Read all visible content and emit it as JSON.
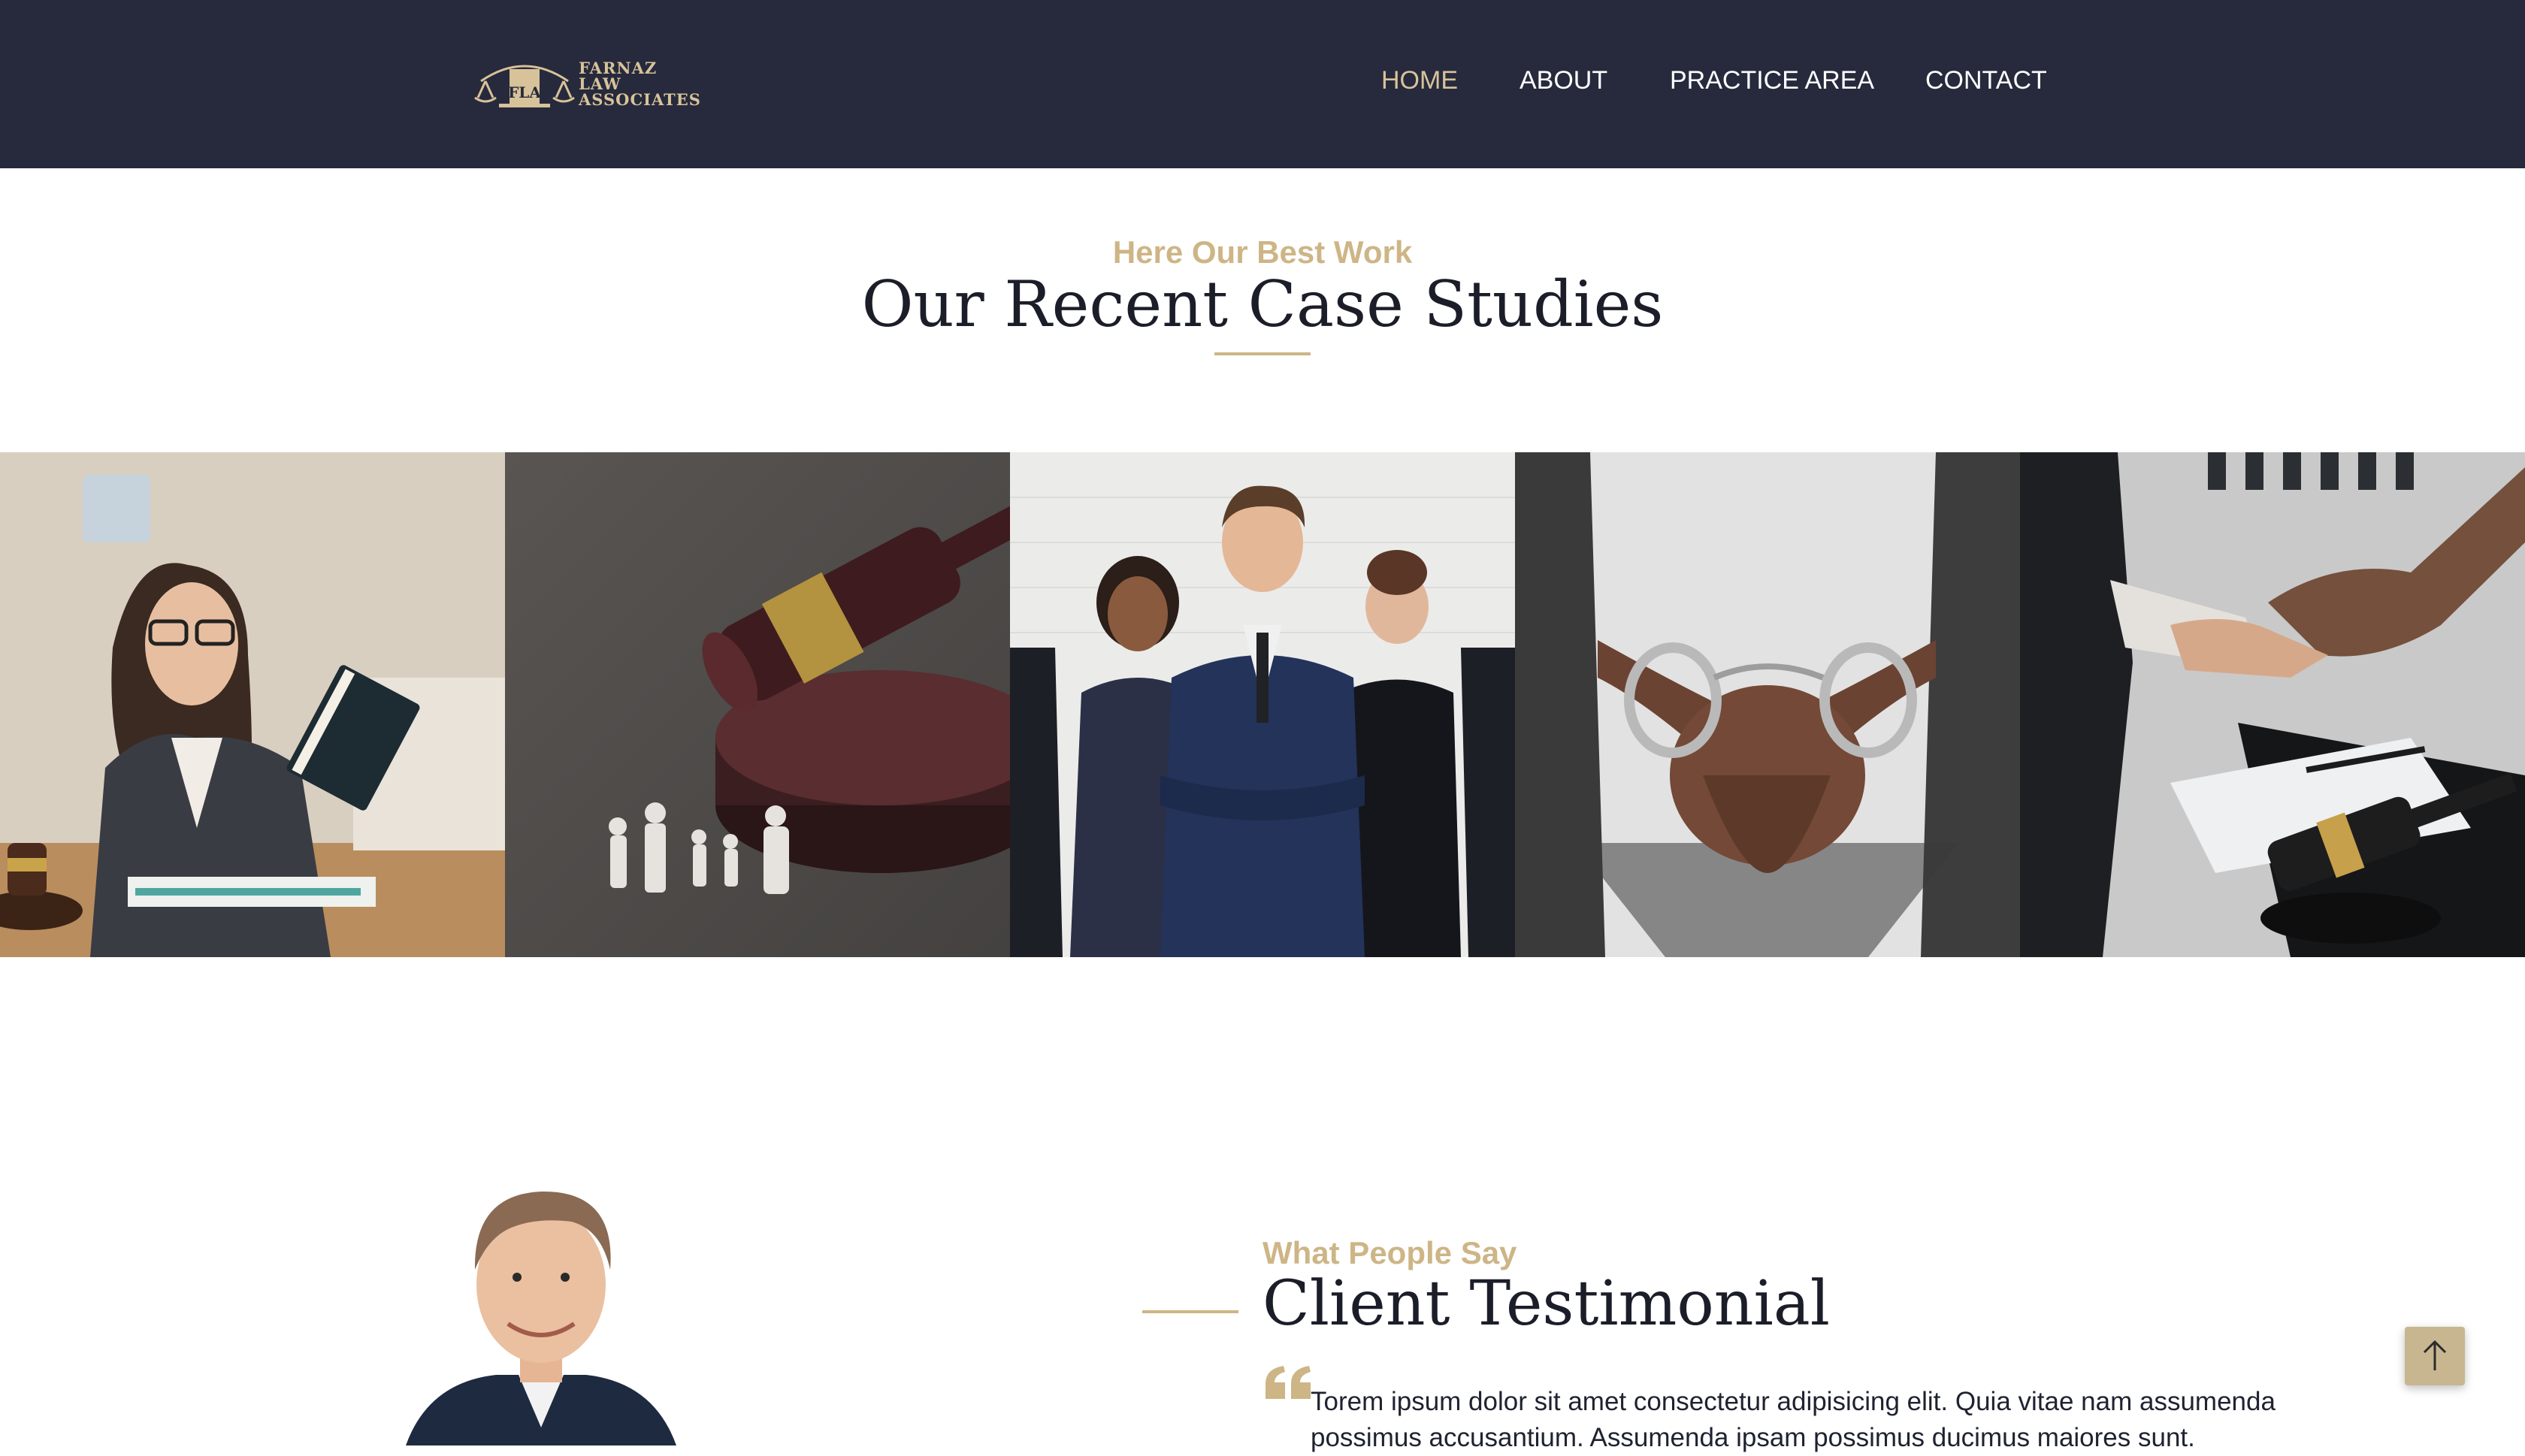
{
  "header": {
    "logo": {
      "monogram": "FLA",
      "lines": [
        "FARNAZ",
        "LAW",
        "ASSOCIATES"
      ]
    },
    "nav": [
      {
        "label": "HOME",
        "active": true
      },
      {
        "label": "ABOUT",
        "active": false
      },
      {
        "label": "PRACTICE AREA",
        "active": false
      },
      {
        "label": "CONTACT",
        "active": false
      }
    ]
  },
  "case_studies": {
    "subtitle": "Here Our Best Work",
    "title": "Our Recent Case Studies",
    "images": [
      "woman-lawyer-reading-photo",
      "gavel-paper-family-photo",
      "business-team-photo",
      "handcuffed-hands-photo",
      "handshake-gavel-photo"
    ]
  },
  "testimonial": {
    "subtitle": "What People Say",
    "title": "Client Testimonial",
    "text": "Torem ipsum dolor sit amet consectetur adipisicing elit. Quia vitae nam assumenda possimus accusantium. Assumenda ipsam possimus ducimus maiores sunt."
  },
  "colors": {
    "nav_bg": "#262a3c",
    "accent": "#cdb586",
    "text_dark": "#1b1d29"
  },
  "icons": {
    "quote": "quote-icon",
    "scroll_top": "arrow-up-icon"
  }
}
